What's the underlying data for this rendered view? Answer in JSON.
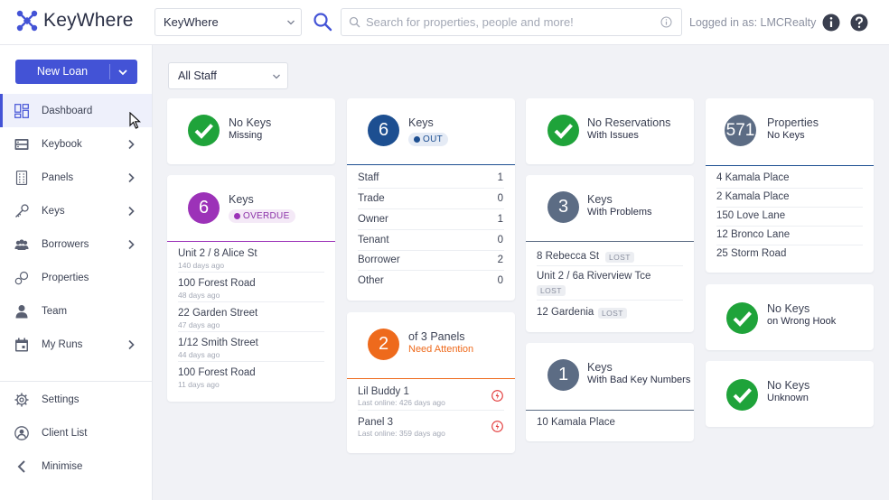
{
  "app": {
    "name": "KeyWhere"
  },
  "header": {
    "agency_selected": "KeyWhere",
    "search_placeholder": "Search for properties, people and more!",
    "logged_in_text": "Logged in as: LMCRealty"
  },
  "sidebar": {
    "new_loan_label": "New Loan",
    "items": [
      {
        "label": "Dashboard",
        "icon": "dashboard-icon"
      },
      {
        "label": "Keybook",
        "icon": "keybook-icon"
      },
      {
        "label": "Panels",
        "icon": "panels-icon"
      },
      {
        "label": "Keys",
        "icon": "keys-icon"
      },
      {
        "label": "Borrowers",
        "icon": "borrowers-icon"
      },
      {
        "label": "Properties",
        "icon": "properties-icon"
      },
      {
        "label": "Team",
        "icon": "team-icon"
      },
      {
        "label": "My Runs",
        "icon": "calendar-icon"
      }
    ],
    "bottom_items": [
      {
        "label": "Settings",
        "icon": "gear-icon"
      },
      {
        "label": "Client List",
        "icon": "client-list-icon"
      },
      {
        "label": "Minimise",
        "icon": "chevron-left-icon"
      }
    ]
  },
  "filters": {
    "staff_selected": "All Staff"
  },
  "colors": {
    "accent": "#4353d6",
    "success": "#1fa33a",
    "navy": "#1d4f91",
    "purple": "#9c32b8",
    "orange": "#ee6a1c",
    "slate": "#5c6c84",
    "danger": "#e23838"
  },
  "cards": {
    "no_keys_missing": {
      "title": "No Keys",
      "subtitle": "Missing"
    },
    "overdue": {
      "count": "6",
      "title": "Keys",
      "badge": "OVERDUE",
      "rows": [
        {
          "address": "Unit 2 / 8 Alice St",
          "ago": "140 days ago"
        },
        {
          "address": "100 Forest Road",
          "ago": "48 days ago"
        },
        {
          "address": "22 Garden Street",
          "ago": "47 days ago"
        },
        {
          "address": "1/12 Smith Street",
          "ago": "44 days ago"
        },
        {
          "address": "100 Forest Road",
          "ago": "11 days ago"
        }
      ]
    },
    "keys_out": {
      "count": "6",
      "title": "Keys",
      "badge": "OUT",
      "rows": [
        {
          "label": "Staff",
          "value": "1"
        },
        {
          "label": "Trade",
          "value": "0"
        },
        {
          "label": "Owner",
          "value": "1"
        },
        {
          "label": "Tenant",
          "value": "0"
        },
        {
          "label": "Borrower",
          "value": "2"
        },
        {
          "label": "Other",
          "value": "0"
        }
      ]
    },
    "panels": {
      "count": "2",
      "title": "of 3 Panels",
      "subtitle": "Need Attention",
      "rows": [
        {
          "name": "Lil Buddy 1",
          "status": "Last online: 426 days ago"
        },
        {
          "name": "Panel 3",
          "status": "Last online: 359 days ago"
        }
      ]
    },
    "no_reservations": {
      "title": "No Reservations",
      "subtitle": "With Issues"
    },
    "problems": {
      "count": "3",
      "title": "Keys",
      "subtitle": "With Problems",
      "rows": [
        {
          "address": "8 Rebecca St",
          "tag": "LOST"
        },
        {
          "address": "Unit 2 / 6a Riverview Tce",
          "tag": "LOST"
        },
        {
          "address": "12 Gardenia",
          "tag": "LOST"
        }
      ]
    },
    "bad_numbers": {
      "count": "1",
      "title": "Keys",
      "subtitle": "With Bad Key Numbers",
      "rows": [
        {
          "address": "10 Kamala Place"
        }
      ]
    },
    "properties": {
      "count": "571",
      "title": "Properties",
      "subtitle": "No Keys",
      "rows": [
        {
          "address": "4 Kamala Place"
        },
        {
          "address": "2 Kamala Place"
        },
        {
          "address": "150 Love Lane"
        },
        {
          "address": "12 Bronco Lane"
        },
        {
          "address": "25 Storm Road"
        }
      ]
    },
    "wrong_hook": {
      "title": "No Keys",
      "subtitle": "on Wrong Hook"
    },
    "unknown": {
      "title": "No Keys",
      "subtitle": "Unknown"
    }
  }
}
